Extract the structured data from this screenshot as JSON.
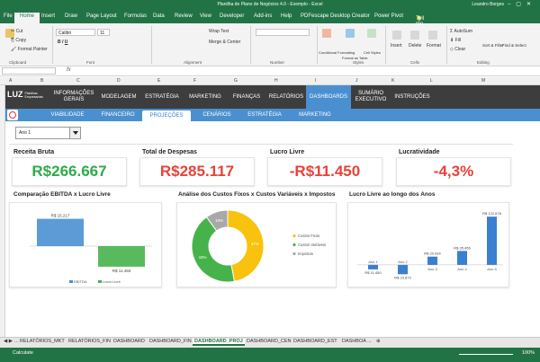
{
  "window": {
    "title": "Planilha de Plano de Negócios 4.0 - Exemplo - Excel",
    "user": "Leandro Borges"
  },
  "ribbon_tabs": [
    "File",
    "Home",
    "Insert",
    "Draw",
    "Page Layout",
    "Formulas",
    "Data",
    "Review",
    "View",
    "Developer",
    "Add-ins",
    "Help",
    "PDFescape Desktop Creator",
    "Power Pivot"
  ],
  "tell_me": "Tell me what you want to do",
  "ribbon": {
    "cut": "Cut",
    "copy": "Copy",
    "format_painter": "Format Painter",
    "font_name": "Calibri",
    "font_size": "11",
    "wrap_text": "Wrap Text",
    "merge_center": "Merge & Center",
    "conditional_formatting": "Conditional Formatting",
    "format_as_table": "Format as Table",
    "cell_styles": "Cell Styles",
    "insert": "Insert",
    "delete": "Delete",
    "format": "Format",
    "autosum": "AutoSum",
    "fill": "Fill",
    "clear": "Clear",
    "sort_filter": "Sort & Filter",
    "find_select": "Find & Select",
    "groups": [
      "Clipboard",
      "Font",
      "Alignment",
      "Number",
      "Styles",
      "Cells",
      "Editing"
    ]
  },
  "columns": [
    "A",
    "B",
    "C",
    "D",
    "E",
    "F",
    "G",
    "H",
    "I",
    "J",
    "K",
    "L",
    "M"
  ],
  "nav": {
    "logo": "LUZ",
    "logo_sub": "Planilhas Empresariais",
    "items": [
      "INFORMAÇÕES GERAIS",
      "MODELAGEM",
      "ESTRATÉGIA",
      "MARKETING",
      "FINANÇAS",
      "RELATÓRIOS",
      "DASHBOARDS",
      "SUMÁRIO EXECUTIVO",
      "INSTRUÇÕES"
    ],
    "active": 6
  },
  "subnav": {
    "items": [
      "VIABILIDADE",
      "FINANCEIRO",
      "PROJEÇÕES",
      "CENÁRIOS",
      "ESTRATÉGIA",
      "MARKETING"
    ],
    "active": 2
  },
  "dropdown": {
    "value": "Ano 1"
  },
  "kpis": [
    {
      "title": "Receita Bruta",
      "value": "R$266.667",
      "color": "#2eaa4a"
    },
    {
      "title": "Total de Despesas",
      "value": "R$285.117",
      "color": "#e8413a"
    },
    {
      "title": "Lucro Livre",
      "value": "-R$11.450",
      "color": "#e8413a"
    },
    {
      "title": "Lucratividade",
      "value": "-4,3%",
      "color": "#e8413a"
    }
  ],
  "chart_data": [
    {
      "type": "bar",
      "title": "Comparação EBITDA x Lucro Livre",
      "categories": [
        "EBITDA",
        "Lucro Livre"
      ],
      "values": [
        15217,
        -11450
      ],
      "labels": [
        "R$ 15.217",
        "R$ 11.450"
      ],
      "colors": [
        "#4a90d0",
        "#46b34a"
      ],
      "legend": "bottom",
      "ylim": [
        -15000,
        17000
      ]
    },
    {
      "type": "pie",
      "title": "Análise dos Custos Fixos x Custos Variáveis x Impostos",
      "categories": [
        "Custos Fixos",
        "Custos Variáveis",
        "Impostos"
      ],
      "values": [
        47,
        43,
        10
      ],
      "labels": [
        "47%",
        "43%",
        "10%"
      ],
      "colors": [
        "#f8c20e",
        "#46b34a",
        "#a8a8a8"
      ],
      "legend": "right"
    },
    {
      "type": "bar",
      "title": "Lucro Livre ao longo dos Anos",
      "categories": [
        "Ano 1",
        "Ano 2",
        "Ano 3",
        "Ano 4",
        "Ano 5"
      ],
      "values": [
        -11450,
        -23873,
        20934,
        35456,
        122678
      ],
      "labels": [
        "R$ 11.450",
        "R$ 23.873",
        "R$ 20.934",
        "R$ 35.456",
        "R$ 122.678"
      ],
      "colors": [
        "#3a7fd0"
      ],
      "ylim": [
        -30000,
        130000
      ]
    }
  ],
  "sheet_tabs": [
    "RELATÓRIOS_MKT",
    "RELATÓRIOS_FIN",
    "DASHBOARD",
    "DASHBOARD_FIN",
    "DASHBOARD_PROJ",
    "DASHBOARD_CEN",
    "DASHBOARD_EST",
    "DASHBOA ..."
  ],
  "active_sheet": 4,
  "status": {
    "ready": "Calculate",
    "zoom": "100%"
  },
  "colors": {
    "excel_green": "#217346",
    "nav_dark": "#3d3d3d",
    "nav_blue": "#4a90d0"
  }
}
